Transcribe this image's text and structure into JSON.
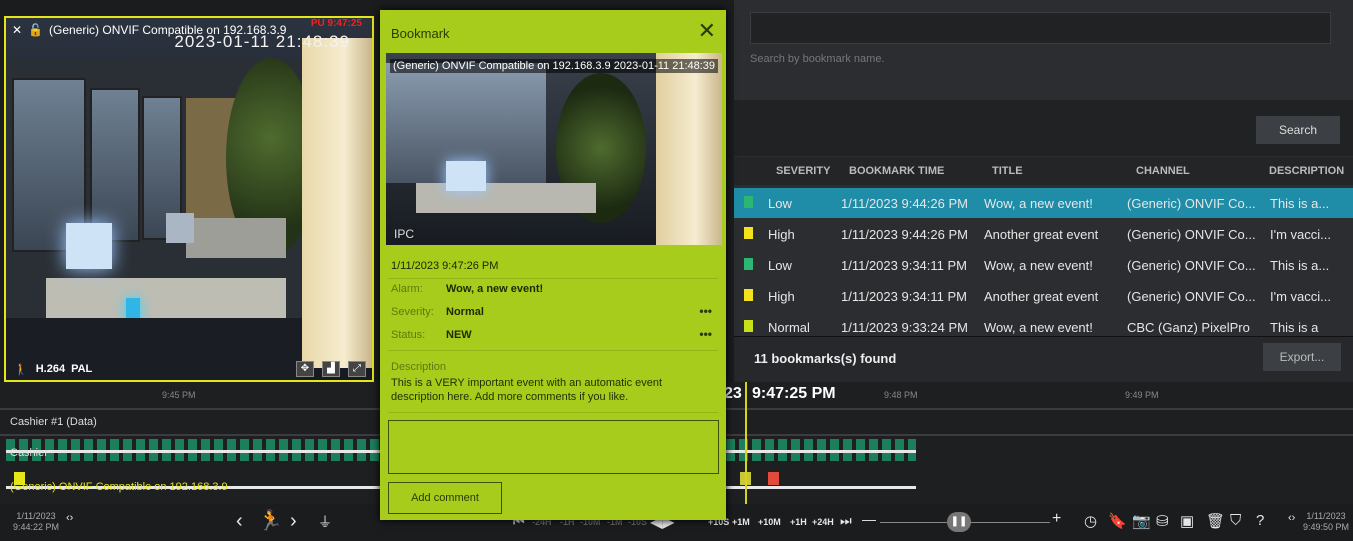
{
  "camera": {
    "title": "(Generic) ONVIF Compatible on 192.168.3.9",
    "timestamp": "2023-01-11 21:48:39",
    "overlay_red": "PU 9:47:25",
    "codec": "H.264",
    "format": "PAL",
    "brand": "IPC"
  },
  "search": {
    "placeholder": "Search by bookmark name.",
    "button_label": "Search"
  },
  "table": {
    "columns": [
      "SEVERITY",
      "BOOKMARK TIME",
      "TITLE",
      "CHANNEL",
      "DESCRIPTION"
    ],
    "rows": [
      {
        "severity": "Low",
        "time": "1/11/2023 9:44:26 PM",
        "title": "Wow, a new event!",
        "channel": "(Generic) ONVIF Co...",
        "description": "This is a...",
        "flag_color": "#2bb673",
        "selected": true
      },
      {
        "severity": "High",
        "time": "1/11/2023 9:44:26 PM",
        "title": "Another great event",
        "channel": "(Generic) ONVIF Co...",
        "description": "I'm vacci...",
        "flag_color": "#f4e21c",
        "selected": false
      },
      {
        "severity": "Low",
        "time": "1/11/2023 9:34:11 PM",
        "title": "Wow, a new event!",
        "channel": "(Generic) ONVIF Co...",
        "description": "This is a...",
        "flag_color": "#2bb673",
        "selected": false
      },
      {
        "severity": "High",
        "time": "1/11/2023 9:34:11 PM",
        "title": "Another great event",
        "channel": "(Generic) ONVIF Co...",
        "description": "I'm vacci...",
        "flag_color": "#f4e21c",
        "selected": false
      },
      {
        "severity": "Normal",
        "time": "1/11/2023 9:33:24 PM",
        "title": "Wow, a new event!",
        "channel": "CBC (Ganz) PixelPro",
        "description": "This is a",
        "flag_color": "#c7e01a",
        "selected": false
      }
    ],
    "found_text": "11 bookmarks(s) found",
    "export_label": "Export..."
  },
  "dialog": {
    "title": "Bookmark",
    "image_caption": "(Generic) ONVIF Compatible on 192.168.3.9 2023-01-11 21:48:39",
    "image_brand": "IPC",
    "time": "1/11/2023 9:47:26 PM",
    "alarm_label": "Alarm:",
    "alarm_value": "Wow, a new event!",
    "severity_label": "Severity:",
    "severity_value": "Normal",
    "status_label": "Status:",
    "status_value": "NEW",
    "description_label": "Description",
    "description_text": "This is a VERY important event with an automatic event description here. Add more comments if you like.",
    "add_comment_label": "Add comment",
    "more_glyph": "•••"
  },
  "timeline": {
    "tick_labels": [
      "9:45 PM",
      "9:48 PM",
      "9:49 PM"
    ],
    "current_time_prefix": "23",
    "current_time": "9:47:25 PM",
    "tracks": [
      "Cashier #1 (Data)",
      "Cashier",
      "(Generic) ONVIF Compatible on 192.168.3.9"
    ]
  },
  "controls": {
    "left_date": "1/11/2023",
    "left_time": "9:44:22 PM",
    "right_date": "1/11/2023",
    "right_time": "9:49:50 PM",
    "speeds_left": [
      "-24H",
      "-1H",
      "-10M",
      "-1M",
      "-10S"
    ],
    "speeds_right": [
      "+10S",
      "+1M",
      "+10M",
      "+1H",
      "+24H"
    ],
    "minus": "—",
    "plus": "+"
  },
  "colors": {
    "accent_yellow": "#e4e61a",
    "dialog_green": "#a8cc1c",
    "selected_row": "#1f8ca8",
    "segment_green": "#1c7f5c"
  }
}
